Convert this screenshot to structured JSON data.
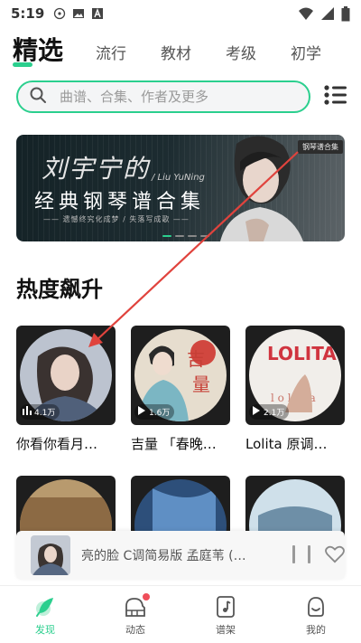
{
  "status_bar": {
    "time": "5:19",
    "left_icons": [
      "podcast-icon",
      "image-icon",
      "a-icon"
    ],
    "right_icons": [
      "wifi-icon",
      "signal-icon",
      "battery-icon"
    ]
  },
  "top_tabs": [
    {
      "label": "精选",
      "active": true
    },
    {
      "label": "流行",
      "active": false
    },
    {
      "label": "教材",
      "active": false
    },
    {
      "label": "考级",
      "active": false
    },
    {
      "label": "初学",
      "active": false
    }
  ],
  "search": {
    "placeholder": "曲谱、合集、作者及更多"
  },
  "banner": {
    "cursive_title": "刘宇宁的",
    "english_name": "/ Liu YuNing",
    "main_title": "经典钢琴谱合集",
    "subtitle": "—— 遗憾终究化成梦 / 失落写成歌 ——",
    "tag": "钢琴谱合集"
  },
  "section": {
    "title": "热度飙升"
  },
  "cards": [
    {
      "title": "你看你看月…",
      "count": "4.1万",
      "count_icon": "bars-icon"
    },
    {
      "title": "吉量 「春晚…",
      "count": "1.6万",
      "count_icon": "play-icon"
    },
    {
      "title": "Lolita 原调…",
      "count": "2.1万",
      "count_icon": "play-icon"
    }
  ],
  "now_playing": {
    "title": "亮的脸 C调简易版 孟庭苇 (…"
  },
  "bottom_nav": [
    {
      "label": "发现",
      "icon": "feather-icon",
      "active": true
    },
    {
      "label": "动态",
      "icon": "piano-icon",
      "active": false
    },
    {
      "label": "谱架",
      "icon": "music-file-icon",
      "active": false
    },
    {
      "label": "我的",
      "icon": "smile-icon",
      "active": false
    }
  ],
  "colors": {
    "accent": "#2bcf8e",
    "badge": "#ef4e5a",
    "annotation_arrow": "#e0433d"
  }
}
